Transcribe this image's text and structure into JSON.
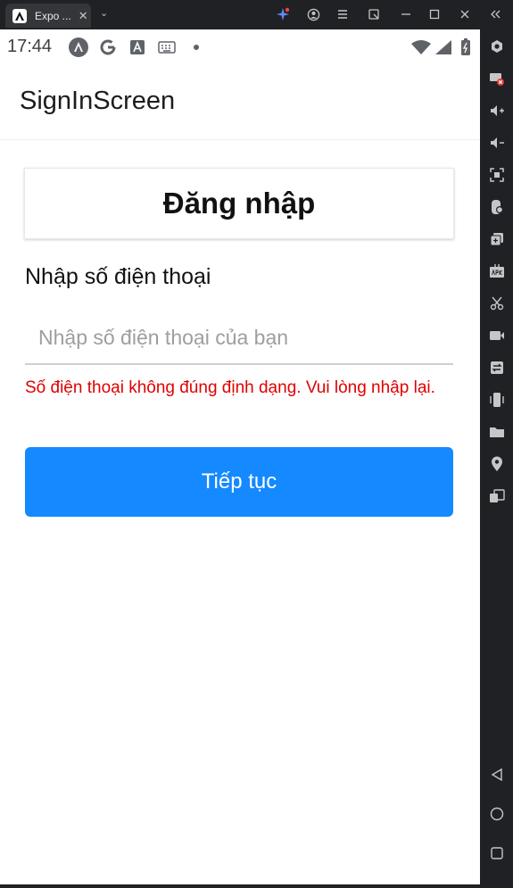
{
  "window": {
    "tab_title": "Expo ...",
    "tab_close": "✕",
    "tab_chevron": "⌄",
    "controls": [
      "minimize-icon",
      "maximize-icon",
      "close-icon",
      "collapse-icon"
    ]
  },
  "status_bar": {
    "time": "17:44",
    "icons": [
      "android-studio-icon",
      "google-icon",
      "font-icon",
      "keyboard-icon",
      "dot-icon",
      "wifi-icon",
      "signal-icon",
      "battery-icon"
    ]
  },
  "app": {
    "header_title": "SignInScreen",
    "card_title": "Đăng nhập",
    "phone_label": "Nhập số điện thoại",
    "phone_value": "",
    "phone_placeholder": "Nhập số điện thoại của bạn",
    "error_message": "Số điện thoại không đúng định dạng. Vui lòng nhập lại.",
    "continue_label": "Tiếp tục"
  },
  "colors": {
    "accent": "#1589ff",
    "error": "#e10000",
    "toolbar_bg": "#202124"
  },
  "side_toolbar": [
    "settings-icon",
    "keyboard-off-icon",
    "volume-up-icon",
    "volume-down-icon",
    "screenshot-icon",
    "rotate-icon",
    "multi-window-icon",
    "apk-icon",
    "cut-icon",
    "record-icon",
    "transfer-icon",
    "shake-icon",
    "folder-icon",
    "location-icon",
    "multi-instance-icon",
    "back-icon",
    "home-icon",
    "recents-icon"
  ]
}
